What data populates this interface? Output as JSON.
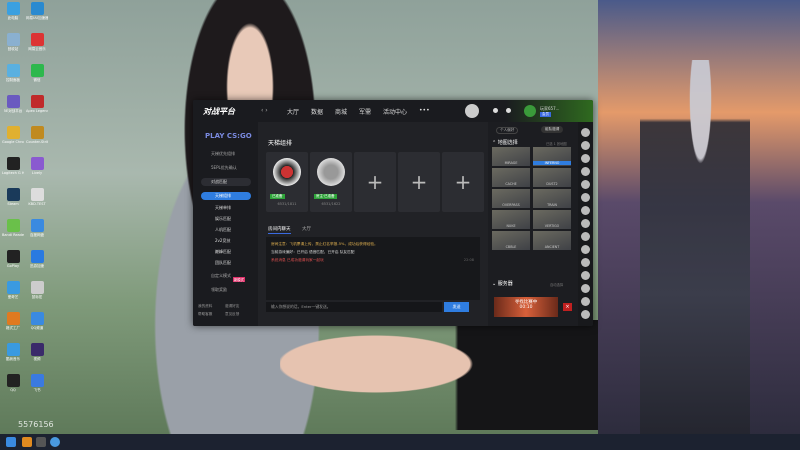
{
  "desktop": {
    "icons": [
      {
        "label": "此电脑",
        "color": "#3aa0e0"
      },
      {
        "label": "网易UU加速器",
        "color": "#2a8ad0"
      },
      {
        "label": "回收站",
        "color": "#8ab0d0"
      },
      {
        "label": "网易云音乐",
        "color": "#d33"
      },
      {
        "label": "控制面板",
        "color": "#5ab0e0"
      },
      {
        "label": "微信",
        "color": "#2db84d"
      },
      {
        "label": "5E对战平台",
        "color": "#6a5ac0"
      },
      {
        "label": "Apex Legends",
        "color": "#c02a2a"
      },
      {
        "label": "Google Chrome",
        "color": "#e0b030"
      },
      {
        "label": "Counter-Strike Global Off...",
        "color": "#c08a20"
      },
      {
        "label": "Logitech G HUB",
        "color": "#222"
      },
      {
        "label": "Lively",
        "color": "#8a5ad0"
      },
      {
        "label": "Steam",
        "color": "#1a3a5a"
      },
      {
        "label": "KBD.TEST",
        "color": "#ddd"
      },
      {
        "label": "Bandi Reader",
        "color": "#6ac04a"
      },
      {
        "label": "百度网盘",
        "color": "#3a8ae0"
      },
      {
        "label": "GoPlay",
        "color": "#222"
      },
      {
        "label": "迅游加速",
        "color": "#2a7ae0"
      },
      {
        "label": "爱奇艺",
        "color": "#3a9ae0"
      },
      {
        "label": "鼠标宏",
        "color": "#ccc"
      },
      {
        "label": "格式工厂",
        "color": "#e07a20"
      },
      {
        "label": "QQ频道",
        "color": "#3a8ae0"
      },
      {
        "label": "酷我音乐",
        "color": "#3a9ae0"
      },
      {
        "label": "视频",
        "color": "#3a2a6a"
      },
      {
        "label": "QQ",
        "color": "#222"
      },
      {
        "label": "飞书",
        "color": "#3a7ae0"
      }
    ],
    "watermark": "5576156"
  },
  "app": {
    "logo": "对战平台",
    "nav": [
      "大厅",
      "数据",
      "商城",
      "军需",
      "活动中心",
      "•••"
    ],
    "user": {
      "name": "玩家657...",
      "badge": "会员"
    },
    "sidebar": {
      "game": "PLAY CS:GO",
      "items": [
        "天梯优先组排",
        "5EPL优先确认",
        "对战匹配",
        "天梯组排",
        "天梯单排",
        "娱乐匹配",
        "人机匹配",
        "2v2竞技",
        "巅峰匹配",
        "团队匹配",
        "自定义模式",
        "领取奖励"
      ],
      "badge": "新模式",
      "footer": [
        "我的资料",
        "邀请好友",
        "帮助客服",
        "意见反馈"
      ]
    },
    "team": {
      "title": "天梯组排",
      "members": [
        {
          "status": "已准备",
          "id": "6531/1811"
        },
        {
          "status": "房主·已准备",
          "id": "6531/1622"
        }
      ]
    },
    "chat": {
      "tabs": [
        "房间内聊天",
        "大厅"
      ],
      "lines": [
        {
          "text": "房间注意：飞机票请上传，禁止红名举报-5%，成功后获得经验。",
          "color": "#e0b050"
        },
        {
          "text": "当前游戏偏好：已开启 语音匹配，已开启 队友匹配",
          "color": "#ddd"
        },
        {
          "text": "系统消息 已成功邀请玩家一起玩",
          "color": "#e05050"
        }
      ],
      "time": "22:08",
      "placeholder": "输入你想说的话，Enter一键发送。",
      "send": "发送"
    },
    "right": {
      "top_buttons": [
        "个人偏好",
        "组队邀请"
      ],
      "maps_title": "地图选择",
      "maps_meta": "已选 1 张地图",
      "maps": [
        "MIRAGE",
        "INFERNO",
        "CACHE",
        "DUST2",
        "OVERPASS",
        "TRAIN",
        "NUKE",
        "VERTIGO",
        "CBBLE",
        "ANCIENT"
      ],
      "selected_map": "INFERNO",
      "server_title": "服务器",
      "server_meta": "自动选择",
      "search_label": "寻找比赛中",
      "search_timer": "00:10",
      "cancel": "×"
    }
  }
}
